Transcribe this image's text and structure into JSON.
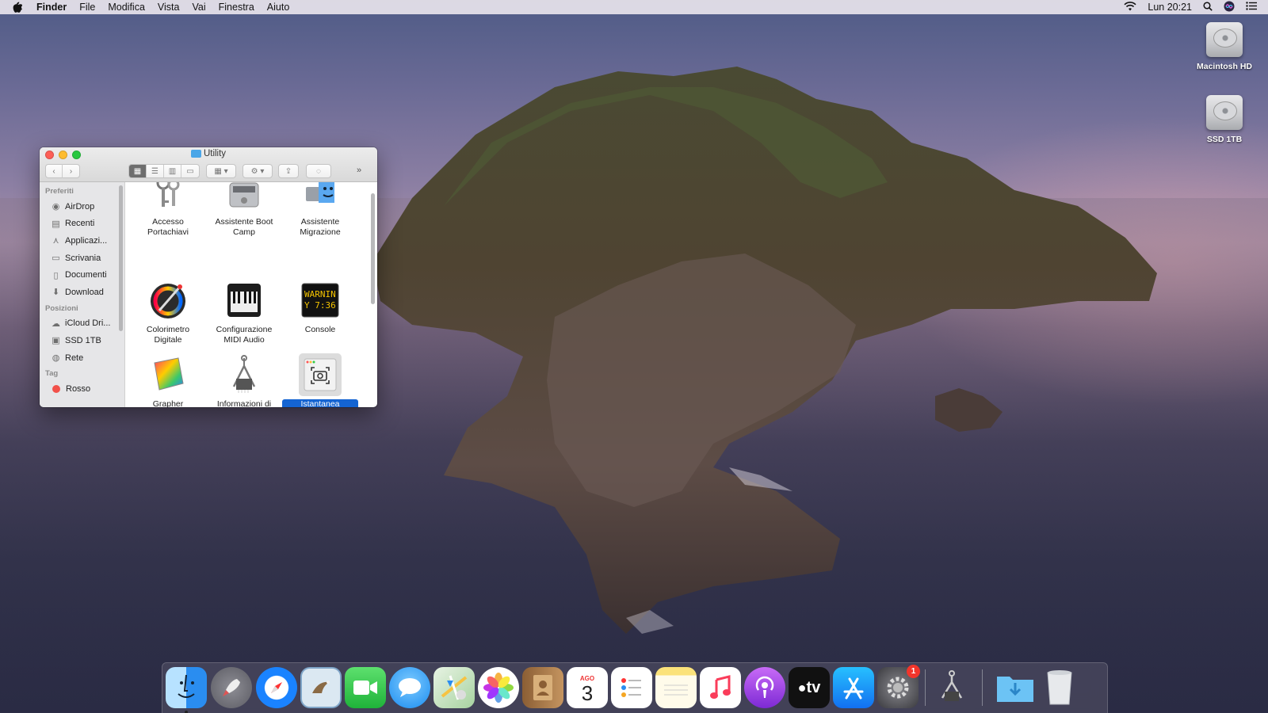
{
  "menubar": {
    "app": "Finder",
    "items": [
      "File",
      "Modifica",
      "Vista",
      "Vai",
      "Finestra",
      "Aiuto"
    ],
    "clock": "Lun 20:21"
  },
  "desktop": {
    "icons": [
      {
        "label": "Macintosh HD"
      },
      {
        "label": "SSD 1TB"
      }
    ]
  },
  "finder": {
    "title": "Utility",
    "sidebar": {
      "favorites_header": "Preferiti",
      "favorites": [
        "AirDrop",
        "Recenti",
        "Applicazi...",
        "Scrivania",
        "Documenti",
        "Download"
      ],
      "locations_header": "Posizioni",
      "locations": [
        "iCloud Dri...",
        "SSD 1TB",
        "Rete"
      ],
      "tags_header": "Tag",
      "tags": [
        "Rosso"
      ]
    },
    "apps": [
      {
        "label": "Accesso Portachiavi",
        "icon": "keychain-icon"
      },
      {
        "label": "Assistente Boot Camp",
        "icon": "bootcamp-icon"
      },
      {
        "label": "Assistente Migrazione",
        "icon": "migration-icon"
      },
      {
        "label": "Colorimetro Digitale",
        "icon": "colorimeter-icon"
      },
      {
        "label": "Configurazione MIDI Audio",
        "icon": "midi-icon"
      },
      {
        "label": "Console",
        "icon": "console-icon"
      },
      {
        "label": "Grapher",
        "icon": "grapher-icon"
      },
      {
        "label": "Informazioni di Sistema",
        "icon": "system-info-icon"
      },
      {
        "label": "Istantanea Schermo",
        "icon": "screenshot-icon",
        "selected": true
      }
    ],
    "console_text": [
      "WARNIN",
      "Y 7:36"
    ]
  },
  "dock": {
    "calendar_month": "AGO",
    "calendar_day": "3",
    "tv_label": "tv",
    "badge_count": "1"
  }
}
